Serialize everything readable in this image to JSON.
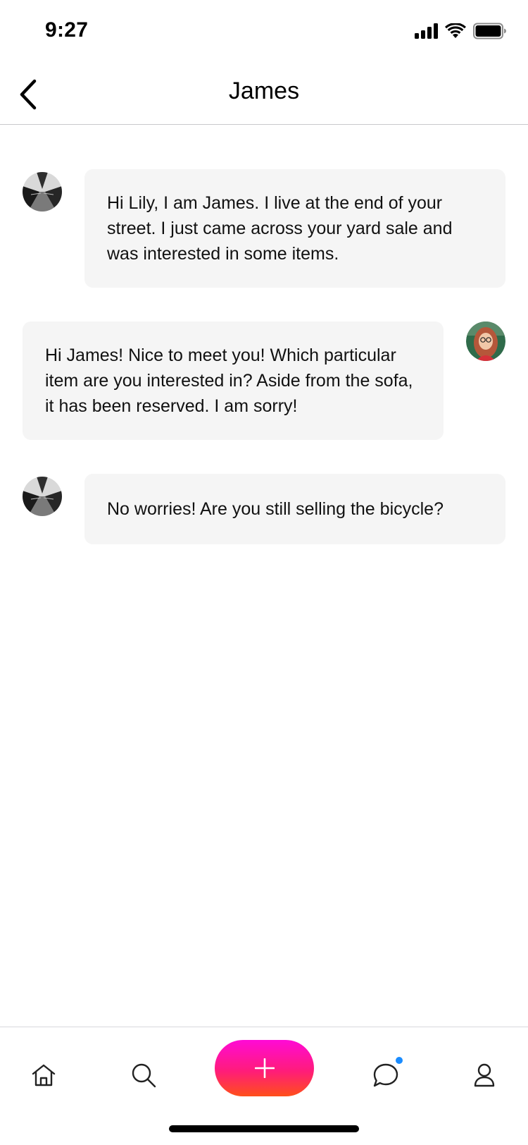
{
  "status_bar": {
    "time": "9:27"
  },
  "header": {
    "title": "James"
  },
  "messages": [
    {
      "sender": "James",
      "text": "Hi Lily, I am James. I live at the end of your street. I just came across your yard sale and was interested in some items."
    },
    {
      "sender": "Lily",
      "text": "Hi James! Nice to meet you! Which particular item are you interested in? Aside from the sofa, it has been reserved. I am sorry!"
    },
    {
      "sender": "James",
      "text": "No worries! Are you still selling the bicycle?"
    }
  ],
  "tabbar": {
    "items": [
      {
        "name": "home",
        "icon": "home-icon"
      },
      {
        "name": "search",
        "icon": "search-icon"
      },
      {
        "name": "add",
        "icon": "plus-icon"
      },
      {
        "name": "messages",
        "icon": "chat-bubble-icon",
        "has_badge": true
      },
      {
        "name": "profile",
        "icon": "user-icon"
      }
    ],
    "badge_color": "#1a8cff",
    "add_gradient": [
      "#ff0ad6",
      "#ff4f1a"
    ]
  }
}
